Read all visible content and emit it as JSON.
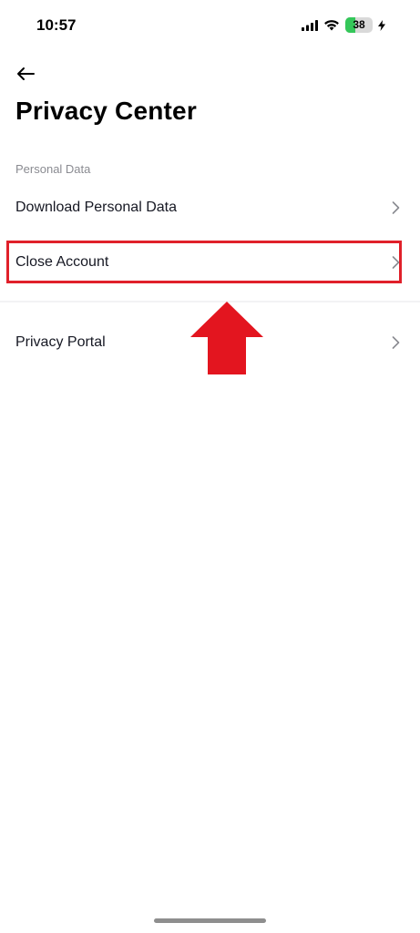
{
  "status_bar": {
    "time": "10:57",
    "battery_level": "38",
    "battery_fraction": 0.38,
    "icons": [
      "signal-icon",
      "wifi-icon",
      "battery-icon",
      "charging-bolt-icon"
    ]
  },
  "header": {
    "back_icon": "arrow-left-icon",
    "title": "Privacy Center"
  },
  "personal_data_section": {
    "label": "Personal Data",
    "items": [
      {
        "label": "Download Personal Data",
        "icon": "chevron-right-icon"
      },
      {
        "label": "Close Account",
        "icon": "chevron-right-icon"
      }
    ]
  },
  "other_section": {
    "items": [
      {
        "label": "Privacy Portal",
        "icon": "chevron-right-icon"
      }
    ]
  },
  "annotation": {
    "highlight_color": "#e0202a",
    "arrow_icon": "red-up-arrow-icon"
  },
  "colors": {
    "text_primary": "#161823",
    "text_secondary": "#8a8b91",
    "battery_green": "#34c759"
  }
}
